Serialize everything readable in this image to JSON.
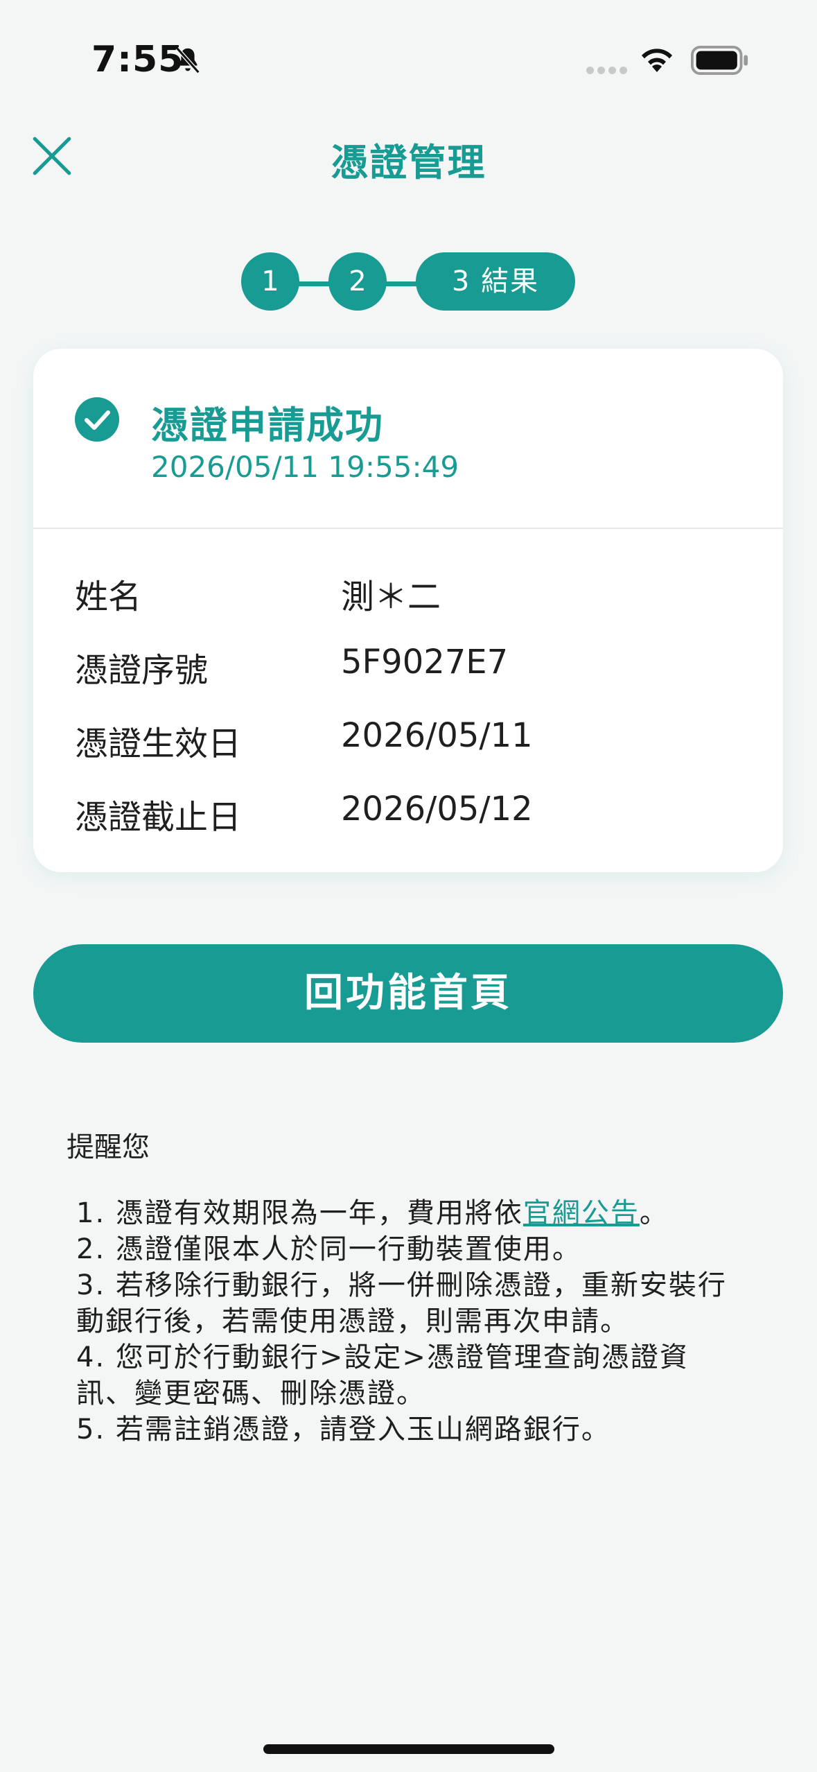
{
  "status_bar": {
    "time": "7:55"
  },
  "header": {
    "title": "憑證管理"
  },
  "stepper": {
    "step1": "1",
    "step2": "2",
    "step3": "3 結果"
  },
  "result": {
    "title": "憑證申請成功",
    "timestamp": "2026/05/11 19:55:49"
  },
  "info": [
    {
      "label": "姓名",
      "value": "測＊二"
    },
    {
      "label": "憑證序號",
      "value": "5F9027E7"
    },
    {
      "label": "憑證生效日",
      "value": "2026/05/11"
    },
    {
      "label": "憑證截止日",
      "value": "2026/05/12"
    }
  ],
  "button": {
    "home_label": "回功能首頁"
  },
  "notes": {
    "title": "提醒您",
    "item1_pre": "1. 憑證有效期限為一年，費用將依",
    "item1_link": "官網公告",
    "item1_post": "。",
    "item2": "2. 憑證僅限本人於同一行動裝置使用。",
    "item3": "3. 若移除行動銀行，將一併刪除憑證，重新安裝行動銀行後，若需使用憑證，則需再次申請。",
    "item4": "4. 您可於行動銀行>設定>憑證管理查詢憑證資訊、變更密碼、刪除憑證。",
    "item5": "5. 若需註銷憑證，請登入玉山網路銀行。"
  },
  "colors": {
    "accent": "#179b93",
    "background": "#f4f6f6"
  }
}
